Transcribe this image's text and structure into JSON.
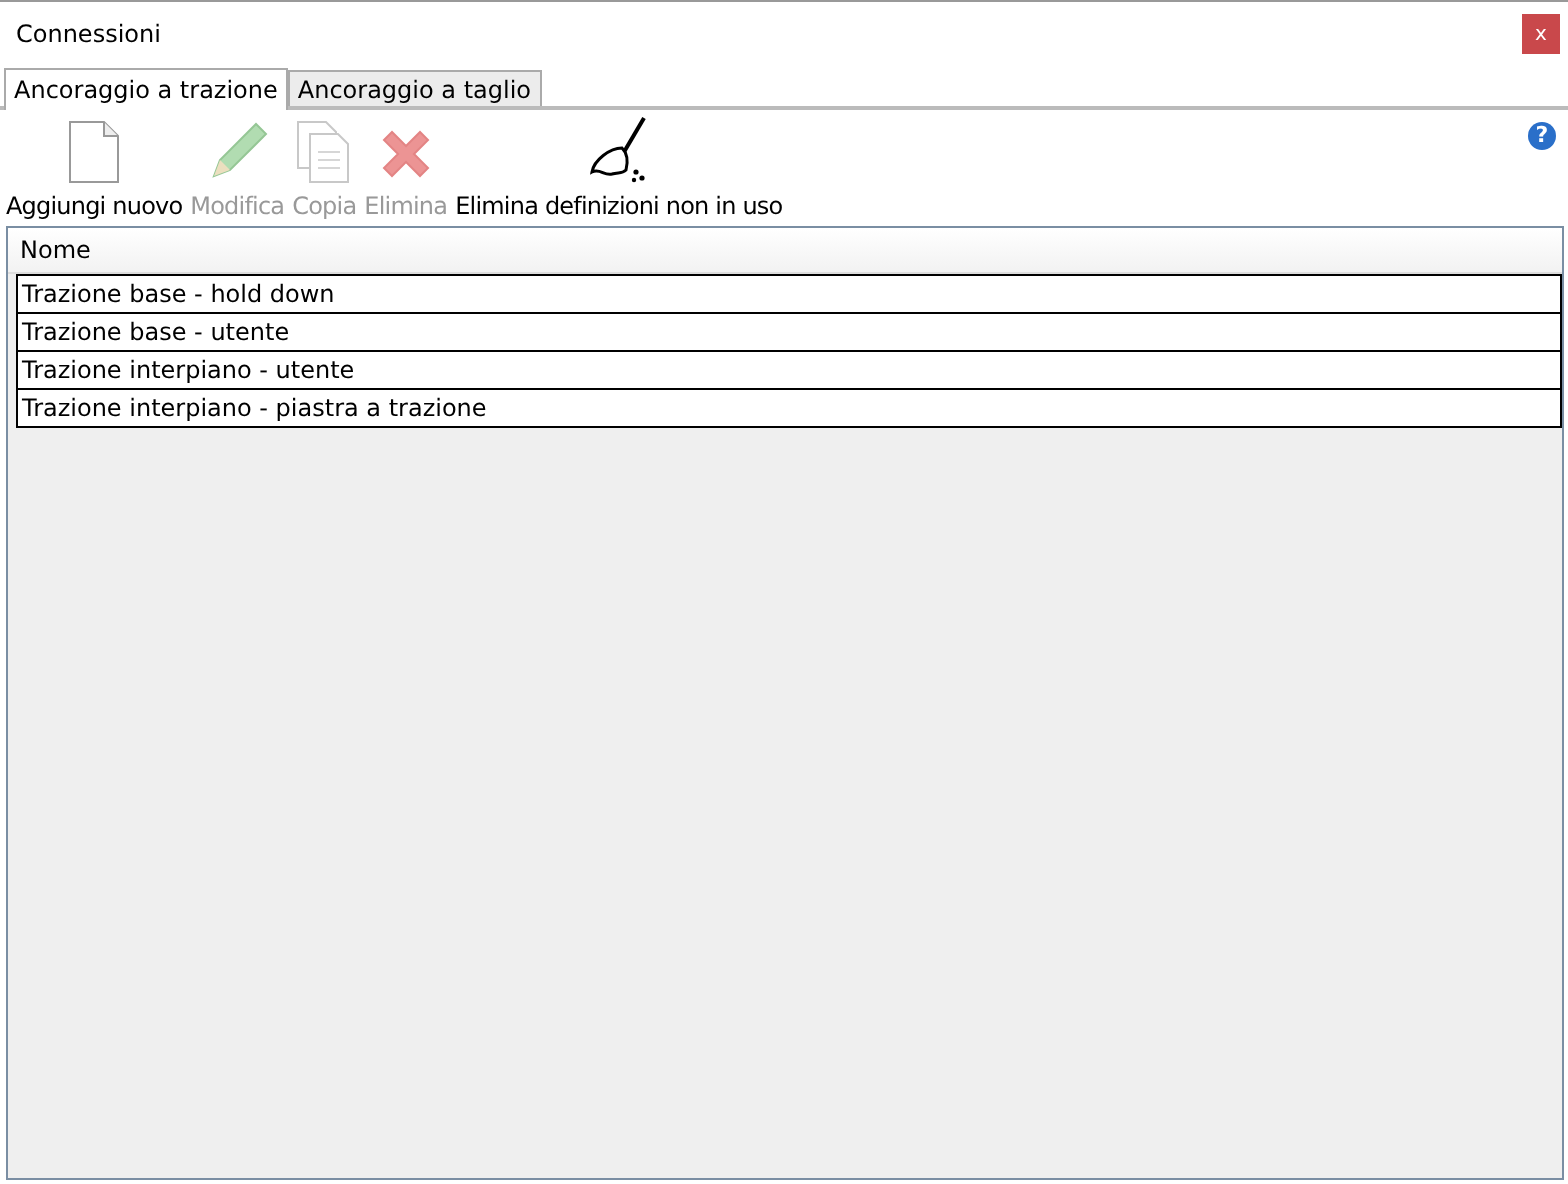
{
  "window": {
    "title": "Connessioni",
    "close": "x"
  },
  "tabs": [
    {
      "label": "Ancoraggio a trazione",
      "selected": true
    },
    {
      "label": "Ancoraggio a taglio",
      "selected": false
    }
  ],
  "toolbar": [
    {
      "label": "Aggiungi nuovo",
      "kind": "new",
      "disabled": false
    },
    {
      "label": "Modifica",
      "kind": "edit",
      "disabled": true
    },
    {
      "label": "Copia",
      "kind": "copy",
      "disabled": true
    },
    {
      "label": "Elimina",
      "kind": "delete",
      "disabled": true
    },
    {
      "label": "Elimina definizioni non in uso",
      "kind": "clean",
      "disabled": false
    }
  ],
  "help": "?",
  "table": {
    "columns": [
      "Nome"
    ],
    "rows": [
      {
        "cells": [
          "Trazione base - hold down"
        ]
      },
      {
        "cells": [
          "Trazione base - utente"
        ]
      },
      {
        "cells": [
          "Trazione interpiano - utente"
        ]
      },
      {
        "cells": [
          "Trazione interpiano - piastra a trazione"
        ]
      }
    ]
  }
}
